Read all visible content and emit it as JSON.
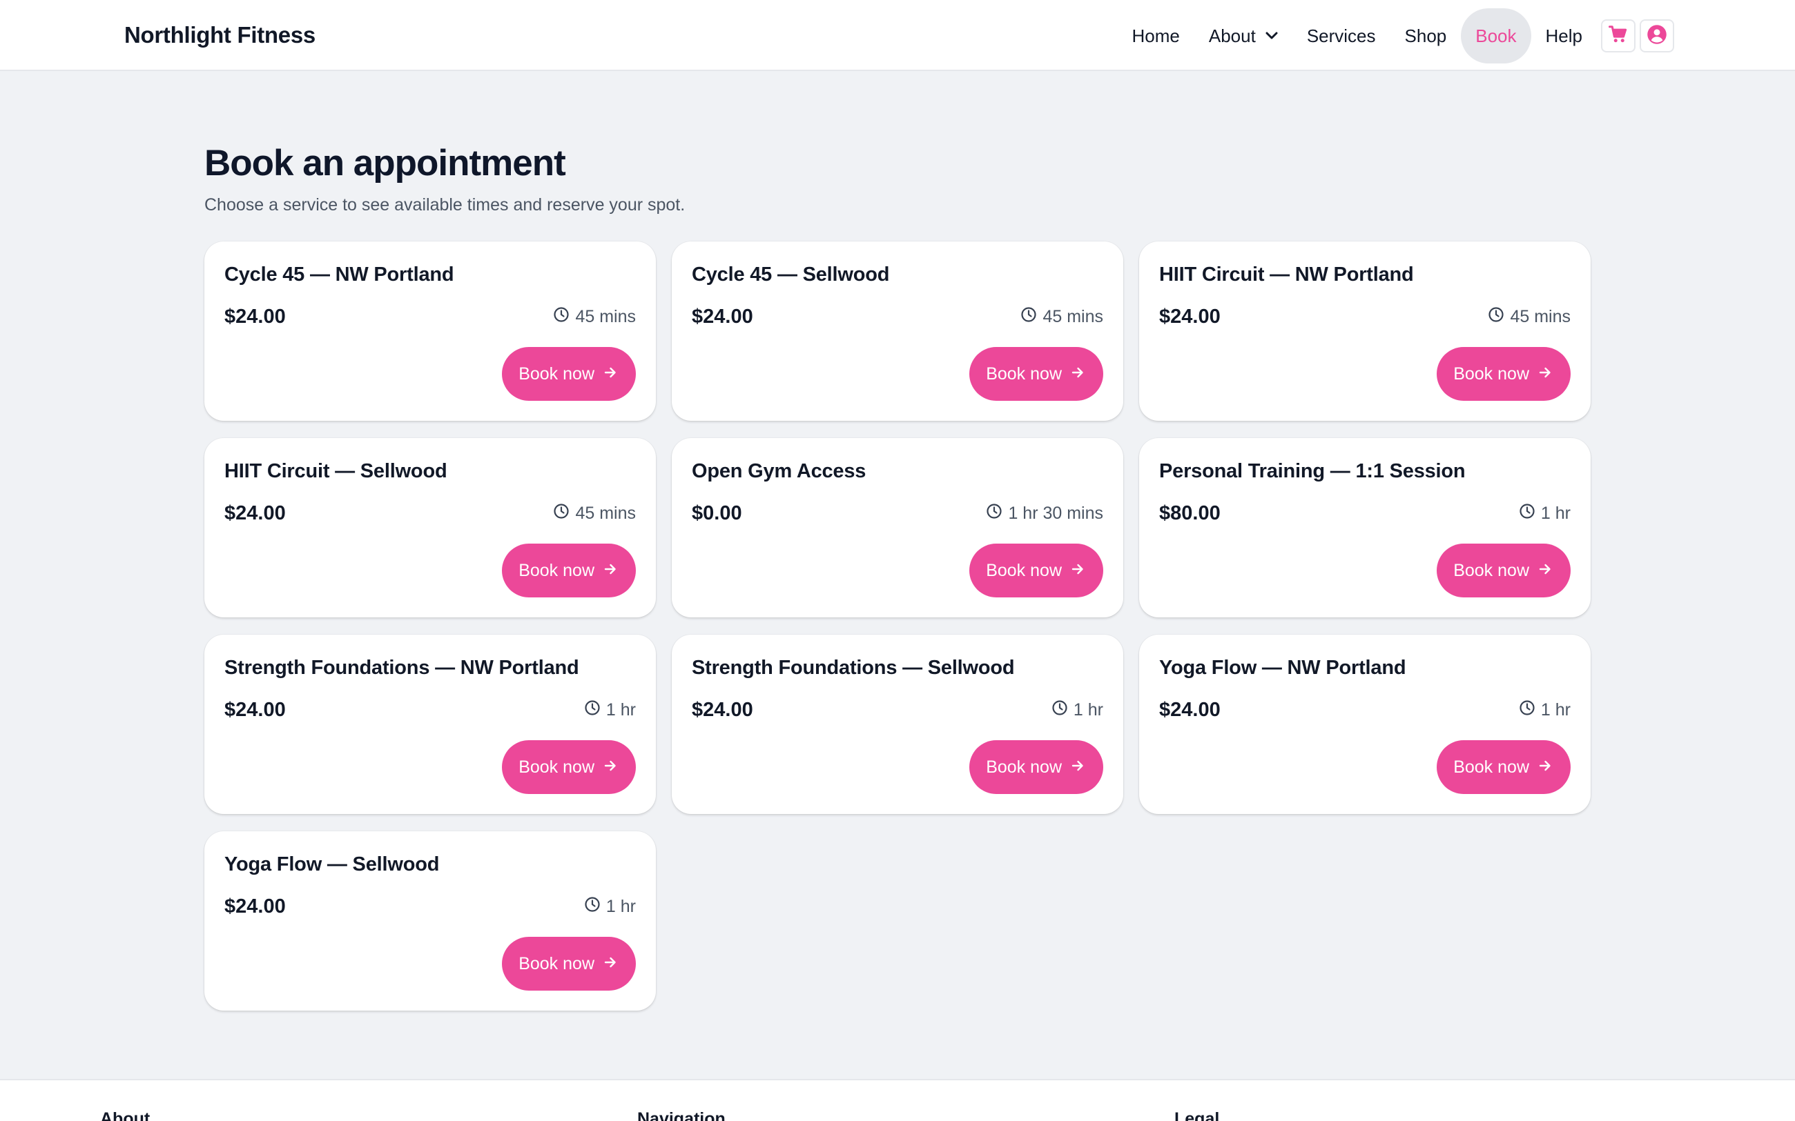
{
  "brand": "Northlight Fitness",
  "nav": {
    "items": [
      {
        "label": "Home",
        "active": false,
        "dropdown": false
      },
      {
        "label": "About",
        "active": false,
        "dropdown": true
      },
      {
        "label": "Services",
        "active": false,
        "dropdown": false
      },
      {
        "label": "Shop",
        "active": false,
        "dropdown": false
      },
      {
        "label": "Book",
        "active": true,
        "dropdown": false
      },
      {
        "label": "Help",
        "active": false,
        "dropdown": false
      }
    ],
    "icons": [
      "cart-icon",
      "account-icon"
    ]
  },
  "colors": {
    "accent": "#ec4899",
    "background": "#f0f2f5",
    "text": "#0f172a",
    "muted": "#4b5563"
  },
  "page": {
    "title": "Book an appointment",
    "subtitle": "Choose a service to see available times and reserve your spot."
  },
  "services": [
    {
      "name": "Cycle 45 — NW Portland",
      "price": "$24.00",
      "duration": "45 mins",
      "button": "Book now"
    },
    {
      "name": "Cycle 45 — Sellwood",
      "price": "$24.00",
      "duration": "45 mins",
      "button": "Book now"
    },
    {
      "name": "HIIT Circuit — NW Portland",
      "price": "$24.00",
      "duration": "45 mins",
      "button": "Book now"
    },
    {
      "name": "HIIT Circuit — Sellwood",
      "price": "$24.00",
      "duration": "45 mins",
      "button": "Book now"
    },
    {
      "name": "Open Gym Access",
      "price": "$0.00",
      "duration": "1 hr 30 mins",
      "button": "Book now"
    },
    {
      "name": "Personal Training — 1:1 Session",
      "price": "$80.00",
      "duration": "1 hr",
      "button": "Book now"
    },
    {
      "name": "Strength Foundations — NW Portland",
      "price": "$24.00",
      "duration": "1 hr",
      "button": "Book now"
    },
    {
      "name": "Strength Foundations — Sellwood",
      "price": "$24.00",
      "duration": "1 hr",
      "button": "Book now"
    },
    {
      "name": "Yoga Flow — NW Portland",
      "price": "$24.00",
      "duration": "1 hr",
      "button": "Book now"
    },
    {
      "name": "Yoga Flow — Sellwood",
      "price": "$24.00",
      "duration": "1 hr",
      "button": "Book now"
    }
  ],
  "footer": {
    "columns": [
      "About",
      "Navigation",
      "Legal"
    ]
  }
}
